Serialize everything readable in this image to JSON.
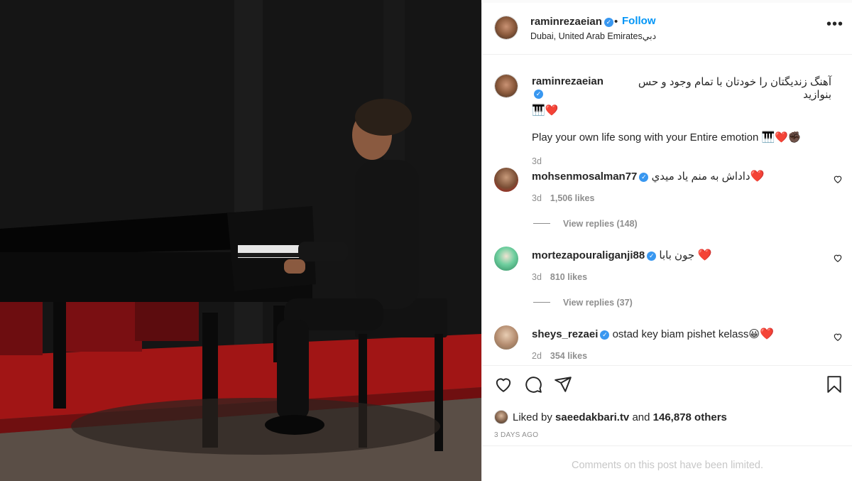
{
  "post": {
    "username": "raminrezaeian",
    "verified_mark": "✓",
    "separator": "•",
    "follow_label": "Follow",
    "location": "Dubai, United Arab Emiratesدبي",
    "more_icon": "•••"
  },
  "caption": {
    "username": "raminrezaeian",
    "text_fa": "آهنگ زندیگتان را خودتان با تمام وجود و حس بنوازید",
    "text_fa_emoji": "🎹❤️",
    "text_en": "Play your own life song with your Entire emotion 🎹❤️✊🏿",
    "time": "3d"
  },
  "comments": [
    {
      "username": "mohsenmosalman77",
      "text": "داداش به منم ياد ميدي",
      "heart": "❤️",
      "time": "3d",
      "likes": "1,506 likes",
      "replies": "View replies (148)"
    },
    {
      "username": "mortezapouraliganji88",
      "text": "جون بابا",
      "heart": "❤️",
      "time": "3d",
      "likes": "810 likes",
      "replies": "View replies (37)"
    },
    {
      "username": "sheys_rezaei",
      "text": "ostad key biam pishet kelass😀",
      "heart": "❤️",
      "time": "2d",
      "likes": "354 likes"
    }
  ],
  "actions": {
    "liked_prefix": "Liked by",
    "liked_user": "saeedakbari.tv",
    "liked_and": "and",
    "liked_others": "146,878 others",
    "time_ago": "3 DAYS AGO",
    "limited_notice": "Comments on this post have been limited."
  },
  "colors": {
    "accent": "#0095f6",
    "verified": "#3897f0",
    "heart": "#e0245e",
    "muted": "#8e8e8e"
  }
}
